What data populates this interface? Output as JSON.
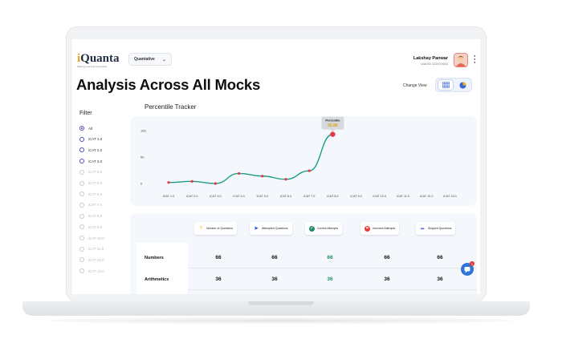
{
  "header": {
    "logo_text": "iQuanta",
    "logo_tagline": "Making Learning Accessible",
    "section_dropdown": "Quantative",
    "user_name": "Lakshay Panwar",
    "user_id": "UserID 122017643"
  },
  "page_title": "Analysis Across All Mocks",
  "change_view_label": "Change View",
  "filter": {
    "title": "Filter",
    "items": [
      {
        "label": "All",
        "state": "selected"
      },
      {
        "label": "iCAT 1.0",
        "state": "enabled"
      },
      {
        "label": "iCAT 2.0",
        "state": "enabled"
      },
      {
        "label": "iCAT 3.0",
        "state": "enabled"
      },
      {
        "label": "iCAT 4.0",
        "state": "disabled"
      },
      {
        "label": "iCAT 5.0",
        "state": "disabled"
      },
      {
        "label": "iCAT 6.0",
        "state": "disabled"
      },
      {
        "label": "iCAT 7.0",
        "state": "disabled"
      },
      {
        "label": "iCAT 8.0",
        "state": "disabled"
      },
      {
        "label": "iCAT 9.0",
        "state": "disabled"
      },
      {
        "label": "iCAT 10.0",
        "state": "disabled"
      },
      {
        "label": "iCAT 11.0",
        "state": "disabled"
      },
      {
        "label": "iCAT 12.0",
        "state": "disabled"
      },
      {
        "label": "iCAT 13.0",
        "state": "disabled"
      }
    ]
  },
  "percentile_tracker": {
    "title": "Percentile Tracker",
    "tooltip_label": "Percentile",
    "tooltip_value": "92.89"
  },
  "chart_data": {
    "type": "line",
    "title": "Percentile Tracker",
    "categories": [
      "iCAT 1.0",
      "iCAT 2.0",
      "iCAT 3.0",
      "iCAT 4.0",
      "iCAT 5.0",
      "iCAT 6.0",
      "iCAT 7.0",
      "iCAT 8.0",
      "iCAT 9.0",
      "iCAT 10.0",
      "iCAT 11.0",
      "iCAT 12.0",
      "iCAT 13.0"
    ],
    "y_ticks": [
      "100",
      "50",
      "0"
    ],
    "ylim": [
      0,
      100
    ],
    "series": [
      {
        "values": [
          2,
          4,
          0,
          19,
          14,
          8,
          24,
          93,
          null,
          null,
          null,
          null,
          null
        ]
      }
    ],
    "highlight_index": 7,
    "line_color": "#1f9d84",
    "point_color": "#e53945",
    "grid": false
  },
  "analysis_table": {
    "columns": [
      {
        "label": "Number of Questions",
        "icon": "question-mark-icon",
        "color": "#f2b51c"
      },
      {
        "label": "Attempted Questions",
        "icon": "cursor-arrow-icon",
        "color": "#2f5fd0"
      },
      {
        "label": "Correct Attempts",
        "icon": "checkmark-icon",
        "color": "#1f8a6b"
      },
      {
        "label": "Incorrect Attempts",
        "icon": "cross-icon",
        "color": "#e53935"
      },
      {
        "label": "Skipped Questions",
        "icon": "skip-icon",
        "color": "#4b4fc7"
      }
    ],
    "rows": [
      {
        "label": "Numbers",
        "values": [
          "66",
          "66",
          "66",
          "66",
          "66"
        ]
      },
      {
        "label": "Arithmetics",
        "values": [
          "36",
          "36",
          "36",
          "36",
          "36"
        ]
      }
    ]
  },
  "chat_badge": "1",
  "colors": {
    "accent": "#4b4fc7",
    "line": "#1f9d84",
    "point": "#e53945",
    "correct": "#1f8a6b"
  }
}
